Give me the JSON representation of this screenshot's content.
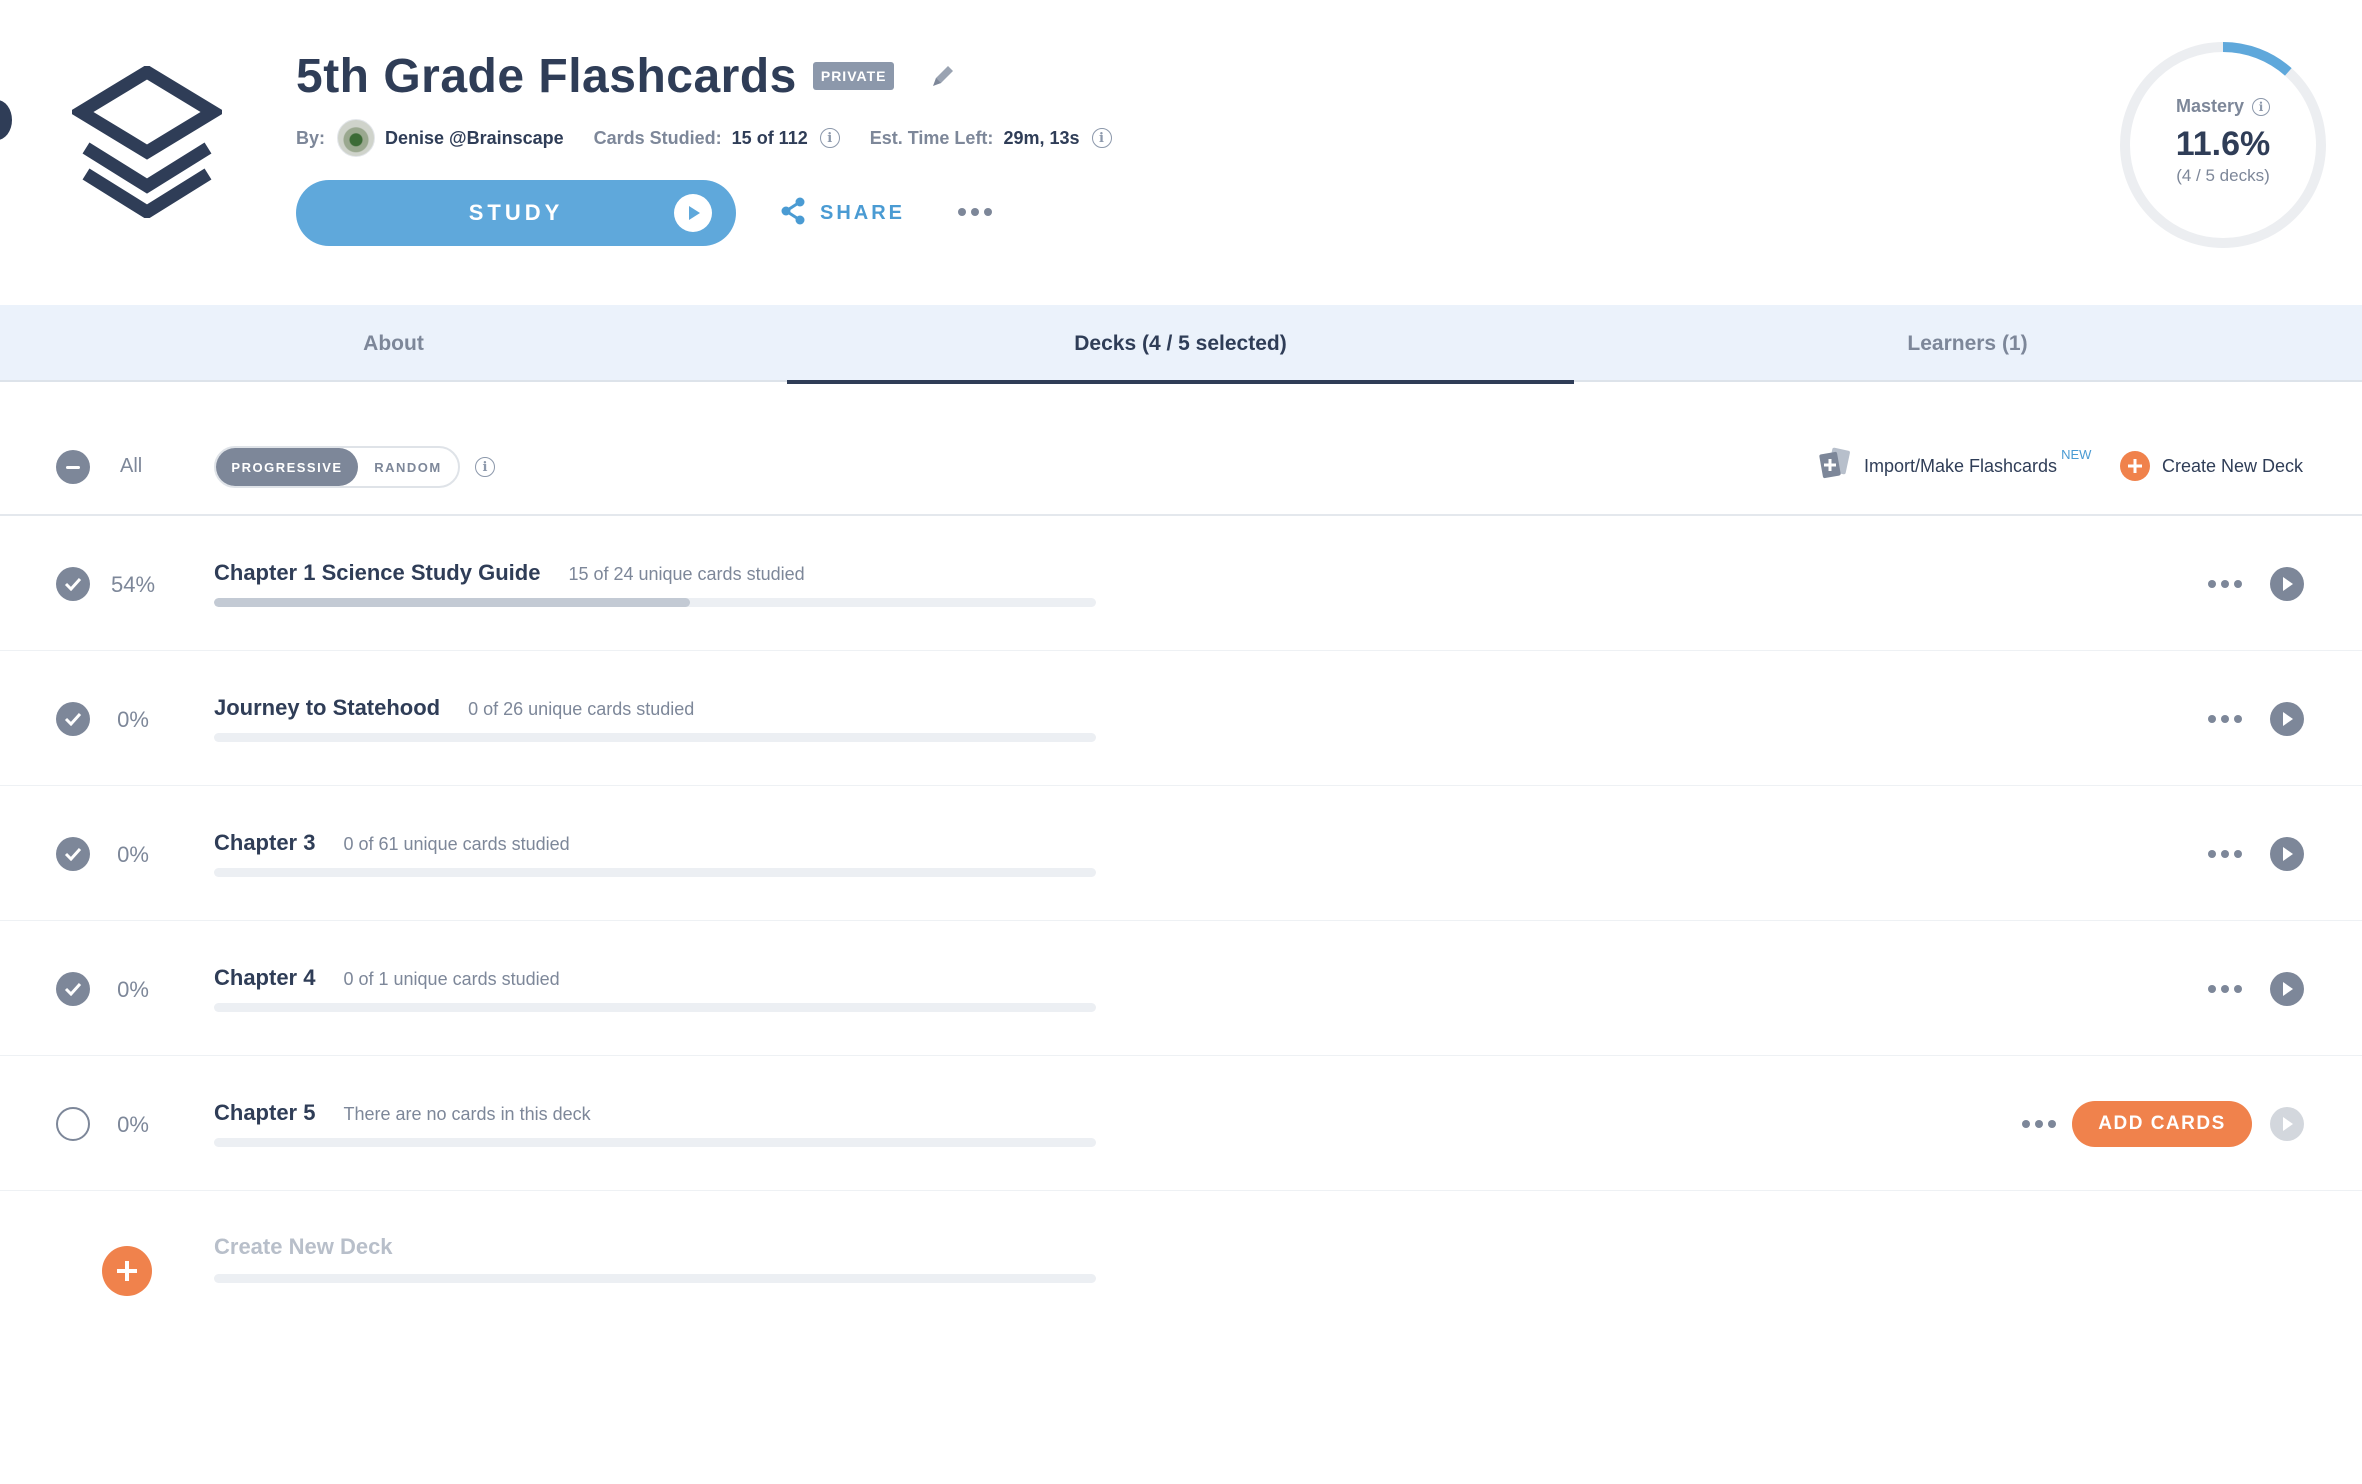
{
  "header": {
    "title": "5th Grade Flashcards",
    "privacy_badge": "PRIVATE",
    "by_label": "By:",
    "author": "Denise @Brainscape",
    "cards_studied_label": "Cards Studied:",
    "cards_studied_value": "15 of 112",
    "time_left_label": "Est. Time Left:",
    "time_left_value": "29m, 13s",
    "study_label": "STUDY",
    "share_label": "SHARE"
  },
  "mastery": {
    "label": "Mastery",
    "value": "11.6%",
    "sub": "(4 / 5 decks)",
    "fraction": 0.116,
    "ring_color": "#5fa8db",
    "track_color": "#eceef1"
  },
  "tabs": [
    {
      "label": "About",
      "active": false
    },
    {
      "label": "Decks (4 / 5 selected)",
      "active": true
    },
    {
      "label": "Learners (1)",
      "active": false
    }
  ],
  "toolbar": {
    "all_label": "All",
    "mode_progressive": "PROGRESSIVE",
    "mode_random": "RANDOM",
    "import_label": "Import/Make Flashcards",
    "import_badge": "NEW",
    "create_label": "Create New Deck"
  },
  "decks": [
    {
      "name": "Chapter 1 Science Study Guide",
      "percent": "54%",
      "subtitle": "15 of 24 unique cards studied",
      "progress": 0.54,
      "selected": true,
      "has_cards": true
    },
    {
      "name": "Journey to Statehood",
      "percent": "0%",
      "subtitle": "0 of 26 unique cards studied",
      "progress": 0,
      "selected": true,
      "has_cards": true
    },
    {
      "name": "Chapter 3",
      "percent": "0%",
      "subtitle": "0 of 61 unique cards studied",
      "progress": 0,
      "selected": true,
      "has_cards": true
    },
    {
      "name": "Chapter 4",
      "percent": "0%",
      "subtitle": "0 of 1 unique cards studied",
      "progress": 0,
      "selected": true,
      "has_cards": true
    },
    {
      "name": "Chapter 5",
      "percent": "0%",
      "subtitle": "There are no cards in this deck",
      "progress": 0,
      "selected": false,
      "has_cards": false,
      "add_cards_label": "ADD CARDS"
    }
  ],
  "create_deck": {
    "placeholder": "Create New Deck"
  },
  "colors": {
    "navy": "#2f3d57",
    "slate": "#7d8799",
    "blue": "#5fa8db",
    "orange": "#f0824c",
    "tab_bg": "#ebf2fb"
  },
  "icons": [
    "layers-logo-icon",
    "pencil-icon",
    "info-icon",
    "play-icon",
    "share-icon",
    "more-icon",
    "check-icon",
    "minus-icon",
    "plus-icon",
    "cards-import-icon"
  ]
}
